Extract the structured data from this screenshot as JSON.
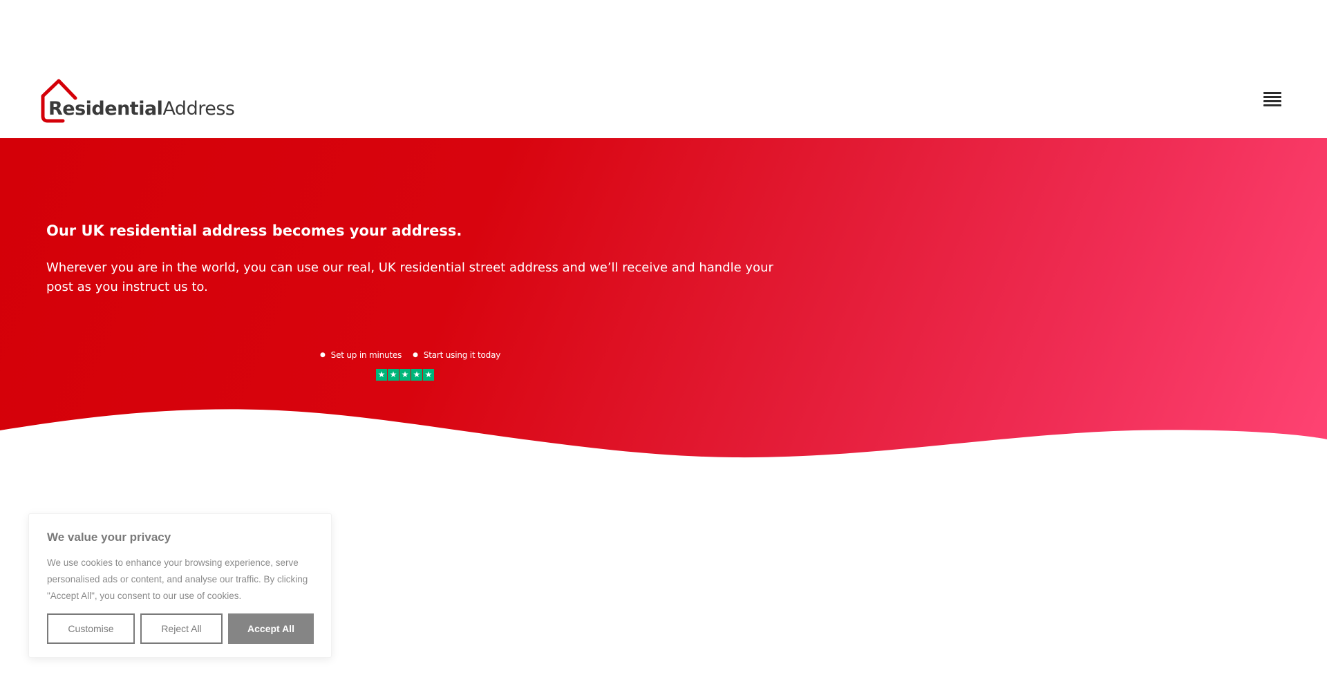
{
  "brand": {
    "logo_bold": "Residential",
    "logo_light": "Address",
    "color_red": "#d40008",
    "color_pink": "#ff4474"
  },
  "header": {
    "menu_icon": "hamburger-menu-icon"
  },
  "hero": {
    "heading": "Our UK residential address becomes your address.",
    "paragraph": "Wherever you are in the world, you can use our real, UK residential street address and we’ll receive and handle your post as you instruct us to.",
    "features": [
      {
        "label": "Set up in minutes",
        "icon": "check-icon"
      },
      {
        "label": "Start using it today",
        "icon": "check-icon"
      }
    ],
    "rating": {
      "stars": 5,
      "max": 5,
      "icon": "trustpilot-star-icon",
      "color": "#00b67a"
    }
  },
  "cookie_banner": {
    "title": "We value your privacy",
    "text": "We use cookies to enhance your browsing experience, serve personalised ads or content, and analyse our traffic. By clicking \"Accept All\", you consent to our use of cookies.",
    "customise_label": "Customise",
    "reject_label": "Reject All",
    "accept_label": "Accept All"
  }
}
